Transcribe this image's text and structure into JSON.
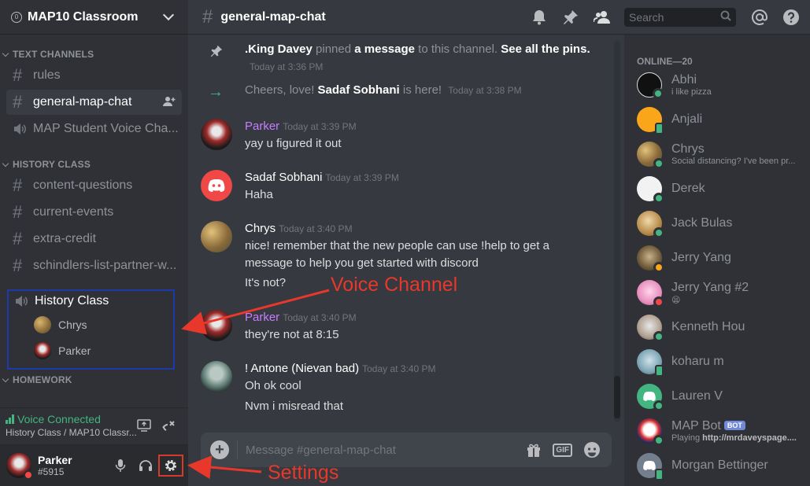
{
  "server": {
    "name": "MAP10 Classroom",
    "badge": "0"
  },
  "categories": {
    "text": "TEXT CHANNELS",
    "history": "HISTORY CLASS",
    "homework": "HOMEWORK"
  },
  "text_channels": [
    {
      "name": "rules"
    },
    {
      "name": "general-map-chat",
      "active": true
    },
    {
      "name": "MAP Student Voice Cha...",
      "voice": true
    }
  ],
  "history_channels": [
    {
      "name": "content-questions"
    },
    {
      "name": "current-events"
    },
    {
      "name": "extra-credit"
    },
    {
      "name": "schindlers-list-partner-w..."
    }
  ],
  "voice_channel": {
    "name": "History Class",
    "users": [
      {
        "name": "Chrys"
      },
      {
        "name": "Parker"
      }
    ]
  },
  "voice_status": {
    "label": "Voice Connected",
    "path": "History Class / MAP10 Classr..."
  },
  "user": {
    "name": "Parker",
    "tag": "#5915"
  },
  "header": {
    "channel": "general-map-chat",
    "search_placeholder": "Search"
  },
  "messages": {
    "pin": {
      "actor": ".King Davey",
      "t1": " pinned ",
      "obj": "a message",
      "t2": " to this channel. ",
      "link": "See all the pins.",
      "time": "Today at 3:36 PM"
    },
    "join": {
      "pre": "Cheers, love! ",
      "who": "Sadaf Sobhani",
      "post": " is here!",
      "time": "Today at 3:38 PM"
    },
    "list": [
      {
        "author": "Parker",
        "time": "Today at 3:39 PM",
        "lines": [
          "yay u figured it out"
        ]
      },
      {
        "author": "Sadaf Sobhani",
        "time": "Today at 3:39 PM",
        "lines": [
          "Haha"
        ]
      },
      {
        "author": "Chrys",
        "time": "Today at 3:40 PM",
        "lines": [
          "nice! remember that the new people can use !help to get a",
          "message to help you get started with discord",
          "It's not?"
        ]
      },
      {
        "author": "Parker",
        "time": "Today at 3:40 PM",
        "lines": [
          "they're not at 8:15"
        ]
      },
      {
        "author": "! Antone (Nievan bad)",
        "time": "Today at 3:40 PM",
        "lines": [
          "Oh ok cool",
          "Nvm i misread that"
        ]
      }
    ]
  },
  "composer": {
    "placeholder": "Message #general-map-chat",
    "gif_label": "GIF"
  },
  "members": {
    "heading": "ONLINE—20",
    "list": [
      {
        "name": "Abhi",
        "activity": "i like pizza"
      },
      {
        "name": "Anjali"
      },
      {
        "name": "Chrys",
        "activity": "Social distancing? I've been pr..."
      },
      {
        "name": "Derek"
      },
      {
        "name": "Jack Bulas"
      },
      {
        "name": "Jerry Yang"
      },
      {
        "name": "Jerry Yang #2",
        "activity": "😫"
      },
      {
        "name": "Kenneth Hou"
      },
      {
        "name": "koharu m"
      },
      {
        "name": "Lauren V"
      },
      {
        "name": "MAP Bot",
        "badge": "BOT",
        "activity_prefix": "Playing ",
        "activity": "http://mrdaveyspage...."
      },
      {
        "name": "Morgan Bettinger"
      }
    ]
  },
  "annotations": {
    "voice_channel": "Voice Channel",
    "settings": "Settings"
  },
  "colors": {
    "accent_red": "#e8382b",
    "highlight_blue": "#1c3aa9",
    "online": "#43b581",
    "dnd": "#f04747",
    "idle": "#faa61a",
    "parker_name": "#c77dff",
    "blurple": "#7289da"
  }
}
